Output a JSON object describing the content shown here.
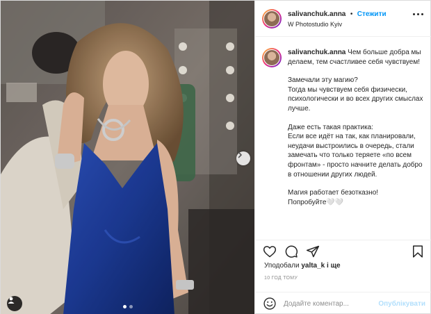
{
  "post": {
    "username": "salivanchuk.anna",
    "separator": "•",
    "follow_label": "Стежити",
    "location": "W Photostudio Kyiv",
    "caption_lines": [
      "Чем больше добра мы делаем, тем счастливее себя чувствуем!",
      "",
      "Замечали эту магию?",
      "Тогда мы чувствуем себя физически, психологически и во всех других смыслах лучше.",
      "",
      "Даже есть такая практика:",
      "Если все идёт на так, как планировали, неудачи выстроились в очередь, стали замечать что только теряете «по всем фронтам» - просто начните делать добро в отношении других людей.",
      "",
      "Магия работает безотказно!",
      "Попробуйте🤍🤍"
    ],
    "likes_prefix": "Уподобали ",
    "likes_user": "yalta_k",
    "likes_suffix": " і ще",
    "timestamp": "10 ГОД ТОМУ",
    "comment_placeholder": "Додайте коментар...",
    "publish_label": "Опублікувати",
    "carousel": {
      "total": 2,
      "current": 1
    }
  },
  "icons": [
    "heart-icon",
    "comment-icon",
    "share-icon",
    "bookmark-icon",
    "more-options-icon",
    "emoji-icon",
    "chevron-right-icon",
    "user-tag-icon"
  ],
  "colors": {
    "accent": "#0095f6",
    "publish_disabled": "#b2dffc",
    "dress": "#1f3d9c",
    "border": "#dbdbdb"
  }
}
